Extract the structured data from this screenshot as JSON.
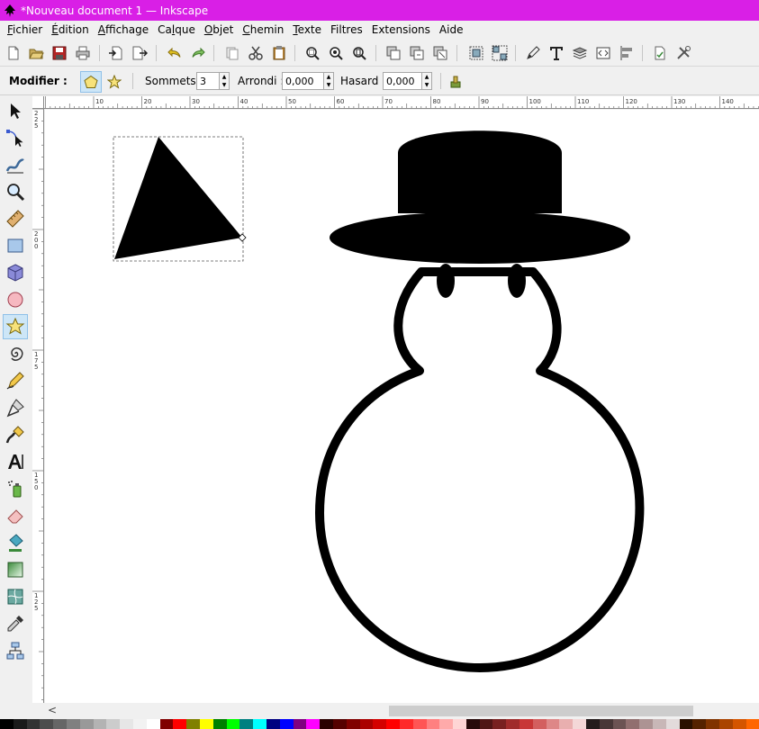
{
  "window": {
    "title": "*Nouveau document 1 — Inkscape"
  },
  "menu": [
    {
      "label": "Fichier",
      "acc": "F",
      "rest": "ichier"
    },
    {
      "label": "Édition",
      "acc": "É",
      "rest": "dition"
    },
    {
      "label": "Affichage",
      "acc": "A",
      "rest": "ffichage"
    },
    {
      "label": "Calque",
      "acc": "C",
      "rest": "alque",
      "pre": "Ca",
      "accmid": "l",
      "post": "que"
    },
    {
      "label": "Objet",
      "acc": "O",
      "rest": "bjet"
    },
    {
      "label": "Chemin",
      "acc": "C",
      "rest": "hemin"
    },
    {
      "label": "Texte",
      "acc": "T",
      "rest": "exte"
    },
    {
      "label": "Filtres",
      "acc": "",
      "rest": "Filtres"
    },
    {
      "label": "Extensions",
      "acc": "",
      "rest": "Extensions"
    },
    {
      "label": "Aide",
      "acc": "",
      "rest": "Aide"
    }
  ],
  "controls": {
    "modifier_label": "Modifier :",
    "sommets_label": "Sommets :",
    "sommets_value": "3",
    "arrondi_label": "Arrondi :",
    "arrondi_value": "0,000",
    "hasard_label": "Hasard :",
    "hasard_value": "0,000"
  },
  "ruler_top": [
    "10",
    "20",
    "30",
    "40",
    "50",
    "60",
    "70",
    "80",
    "90",
    "100",
    "110",
    "120",
    "130",
    "140"
  ],
  "ruler_left": [
    "2 2 5",
    "2 0 0",
    "1 7 5",
    "1 5 0",
    "1 2 5"
  ],
  "palette": [
    "#000000",
    "#1a1a1a",
    "#333333",
    "#4d4d4d",
    "#666666",
    "#808080",
    "#999999",
    "#b3b3b3",
    "#cccccc",
    "#e6e6e6",
    "#f2f2f2",
    "#ffffff",
    "#800000",
    "#ff0000",
    "#808000",
    "#ffff00",
    "#008000",
    "#00ff00",
    "#008080",
    "#00ffff",
    "#000080",
    "#0000ff",
    "#800080",
    "#ff00ff",
    "#2b0000",
    "#550000",
    "#800000",
    "#aa0000",
    "#d40000",
    "#ff0000",
    "#ff2a2a",
    "#ff5555",
    "#ff8080",
    "#ffaaaa",
    "#ffd5d5",
    "#280b0b",
    "#501616",
    "#782121",
    "#a02c2c",
    "#c83737",
    "#d35f5f",
    "#de8787",
    "#e9afaf",
    "#f4d7d7",
    "#241c1c",
    "#483737",
    "#6c5353",
    "#916f6f",
    "#ac9393",
    "#c8b7b7",
    "#e3dbdb",
    "#2b1100",
    "#552200",
    "#803300",
    "#aa4400",
    "#d45500",
    "#ff6600"
  ]
}
